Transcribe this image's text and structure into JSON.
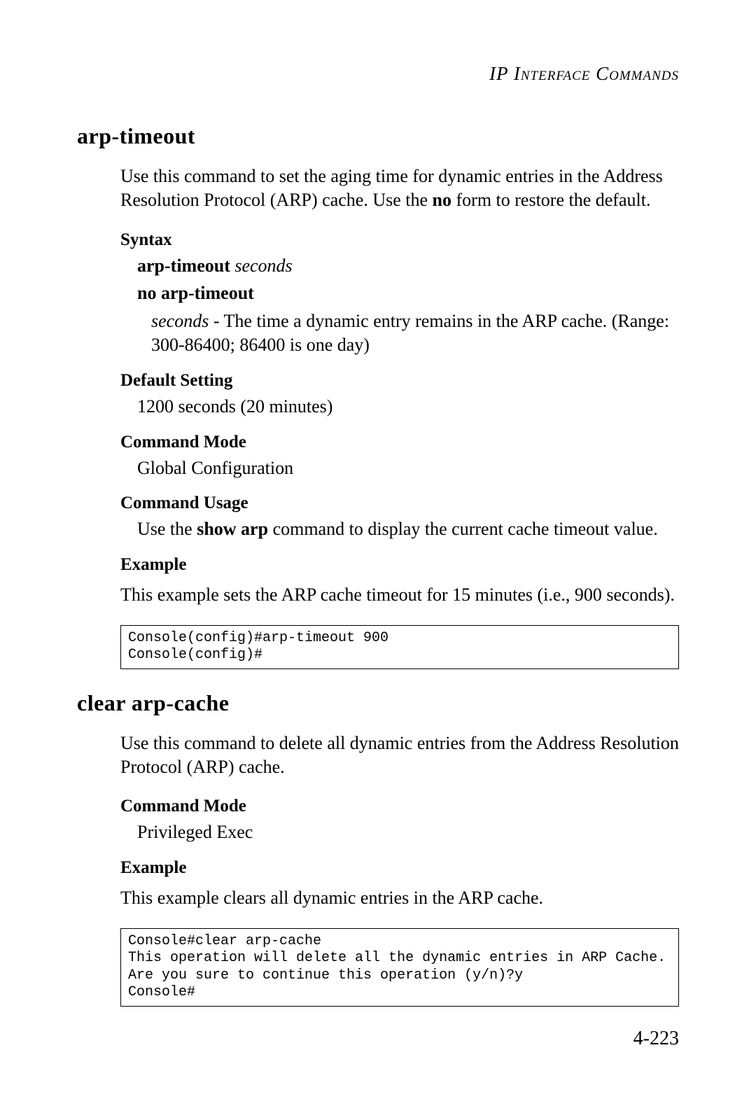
{
  "header": {
    "running_head": "IP Interface Commands"
  },
  "section1": {
    "title": "arp-timeout",
    "intro_pre": "Use this command to set the aging time for dynamic entries in the Address Resolution Protocol (ARP) cache. Use the ",
    "intro_bold": "no",
    "intro_post": " form to restore the default.",
    "syntax_label": "Syntax",
    "syntax_cmd1_bold": "arp-timeout",
    "syntax_cmd1_italic": " seconds",
    "syntax_cmd2_bold": "no arp-timeout",
    "param_lead_italic": "seconds",
    "param_rest": " - The time a dynamic entry remains in the ARP cache. (Range: 300-86400; 86400 is one day)",
    "default_label": "Default Setting",
    "default_value": "1200 seconds (20 minutes)",
    "mode_label": "Command Mode",
    "mode_value": "Global Configuration",
    "usage_label": "Command Usage",
    "usage_pre": "Use the ",
    "usage_bold": "show arp",
    "usage_post": " command to display the current cache timeout value.",
    "example_label": "Example",
    "example_intro": "This example sets the ARP cache timeout for 15 minutes (i.e., 900 seconds).",
    "example_code": "Console(config)#arp-timeout 900\nConsole(config)#"
  },
  "section2": {
    "title": "clear arp-cache",
    "intro": "Use this command to delete all dynamic entries from the Address Resolution Protocol (ARP) cache.",
    "mode_label": "Command Mode",
    "mode_value": "Privileged Exec",
    "example_label": "Example",
    "example_intro": "This example clears all dynamic entries in the ARP cache.",
    "example_code": "Console#clear arp-cache\nThis operation will delete all the dynamic entries in ARP Cache.\nAre you sure to continue this operation (y/n)?y\nConsole#"
  },
  "page_number": "4-223"
}
